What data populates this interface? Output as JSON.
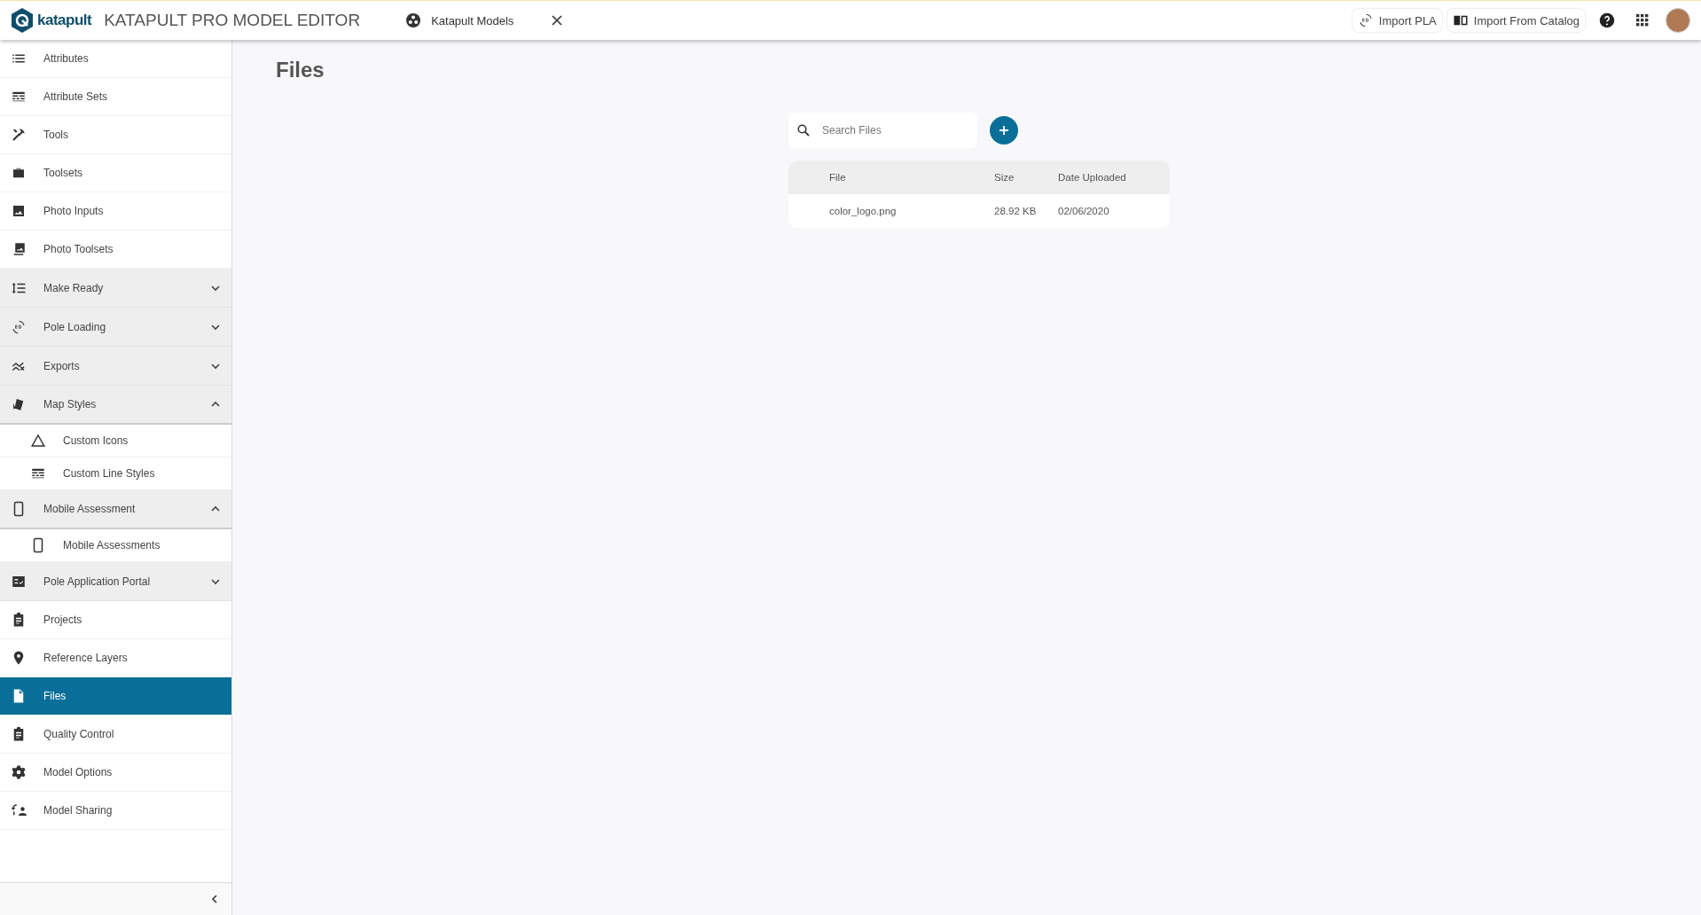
{
  "header": {
    "brand": "katapult",
    "title": "KATAPULT PRO MODEL EDITOR",
    "model_tab": {
      "label": "Katapult Models"
    },
    "actions": [
      {
        "label": "Import PLA"
      },
      {
        "label": "Import From Catalog"
      }
    ]
  },
  "sidebar": {
    "items": [
      {
        "kind": "item",
        "label": "Attributes",
        "selected": false
      },
      {
        "kind": "item",
        "label": "Attribute Sets",
        "selected": false
      },
      {
        "kind": "item",
        "label": "Tools",
        "selected": false
      },
      {
        "kind": "item",
        "label": "Toolsets",
        "selected": false
      },
      {
        "kind": "item",
        "label": "Photo Inputs",
        "selected": false
      },
      {
        "kind": "item",
        "label": "Photo Toolsets",
        "selected": false
      },
      {
        "kind": "group",
        "label": "Make Ready",
        "selected": false,
        "expanded": false
      },
      {
        "kind": "group",
        "label": "Pole Loading",
        "selected": false,
        "expanded": false
      },
      {
        "kind": "group",
        "label": "Exports",
        "selected": false,
        "expanded": false
      },
      {
        "kind": "group",
        "label": "Map Styles",
        "selected": false,
        "expanded": true,
        "children": [
          {
            "label": "Custom Icons",
            "selected": false
          },
          {
            "label": "Custom Line Styles",
            "selected": false
          }
        ]
      },
      {
        "kind": "group",
        "label": "Mobile Assessment",
        "selected": false,
        "expanded": true,
        "children": [
          {
            "label": "Mobile Assessments",
            "selected": false
          }
        ]
      },
      {
        "kind": "group",
        "label": "Pole Application Portal",
        "selected": false,
        "expanded": false
      },
      {
        "kind": "item",
        "label": "Projects",
        "selected": false
      },
      {
        "kind": "item",
        "label": "Reference Layers",
        "selected": false
      },
      {
        "kind": "item",
        "label": "Files",
        "selected": true
      },
      {
        "kind": "item",
        "label": "Quality Control",
        "selected": false
      },
      {
        "kind": "item",
        "label": "Model Options",
        "selected": false
      },
      {
        "kind": "item",
        "label": "Model Sharing",
        "selected": false
      }
    ]
  },
  "page": {
    "title": "Files",
    "search": {
      "placeholder": "Search Files"
    },
    "table": {
      "columns": [
        "File",
        "Size",
        "Date Uploaded"
      ],
      "rows": [
        [
          "color_logo.png",
          "28.92 KB",
          "02/06/2020"
        ]
      ]
    }
  }
}
